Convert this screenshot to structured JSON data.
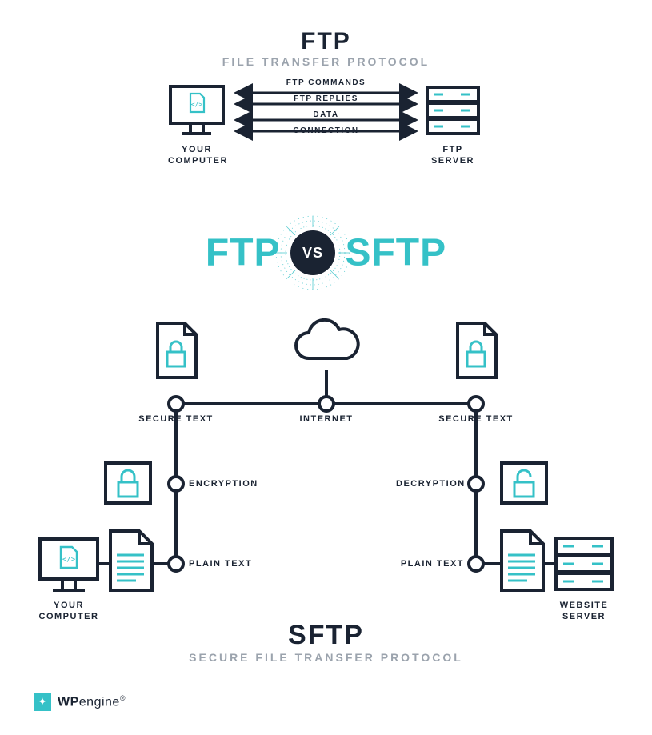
{
  "ftp": {
    "title": "FTP",
    "subtitle": "FILE TRANSFER PROTOCOL",
    "arrows": {
      "commands": "FTP COMMANDS",
      "replies": "FTP REPLIES",
      "data": "DATA",
      "connection": "CONNECTION"
    },
    "left_label_1": "YOUR",
    "left_label_2": "COMPUTER",
    "right_label_1": "FTP",
    "right_label_2": "SERVER"
  },
  "vs": {
    "left": "FTP",
    "badge": "VS",
    "right": "SFTP"
  },
  "sftp": {
    "title": "SFTP",
    "subtitle": "SECURE FILE TRANSFER PROTOCOL",
    "labels": {
      "secure_left": "SECURE TEXT",
      "internet": "INTERNET",
      "secure_right": "SECURE TEXT",
      "encryption": "ENCRYPTION",
      "decryption": "DECRYPTION",
      "plain_left": "PLAIN TEXT",
      "plain_right": "PLAIN TEXT",
      "your_1": "YOUR",
      "your_2": "COMPUTER",
      "server_1": "WEBSITE",
      "server_2": "SERVER"
    }
  },
  "footer": {
    "brand_bold": "WP",
    "brand_rest": "engine",
    "reg": "®"
  },
  "colors": {
    "accent": "#35c1c7",
    "dark": "#1a2332",
    "muted": "#9ba3ad"
  }
}
